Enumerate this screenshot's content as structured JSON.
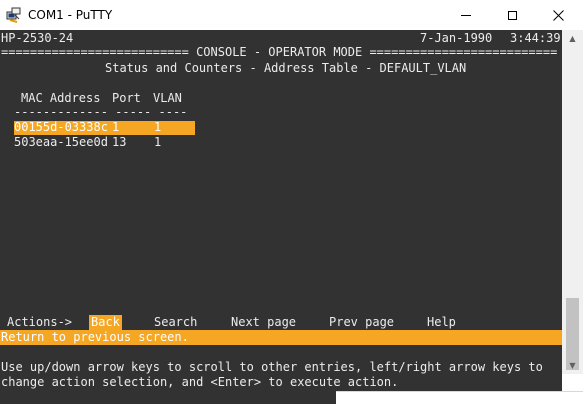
{
  "window": {
    "title": "COM1 - PuTTY"
  },
  "terminal": {
    "host": "HP-2530-24",
    "date": "7-Jan-1990",
    "time": "3:44:39",
    "banner": "========================== CONSOLE - OPERATOR MODE ==========================",
    "screen_title": "Status and Counters - Address Table - DEFAULT_VLAN",
    "columns": [
      "MAC Address",
      "Port",
      "VLAN"
    ],
    "separator": "------------- ----- ----",
    "entries": [
      {
        "mac": "00155d-03338c",
        "port": "1",
        "vlan": "1",
        "selected": true
      },
      {
        "mac": "503eaa-15ee0d",
        "port": "13",
        "vlan": "1",
        "selected": false
      }
    ],
    "actions": {
      "label": "Actions->",
      "items": [
        "Back",
        "Search",
        "Next page",
        "Prev page",
        "Help"
      ],
      "selected": "Back"
    },
    "status_line": "Return to previous screen.",
    "help_text": [
      "Use up/down arrow keys to scroll to other entries, left/right arrow keys to",
      "change action selection, and <Enter> to execute action."
    ]
  },
  "colors": {
    "terminal_bg": "#323232",
    "terminal_fg": "#ececec",
    "highlight": "#f5a623"
  }
}
